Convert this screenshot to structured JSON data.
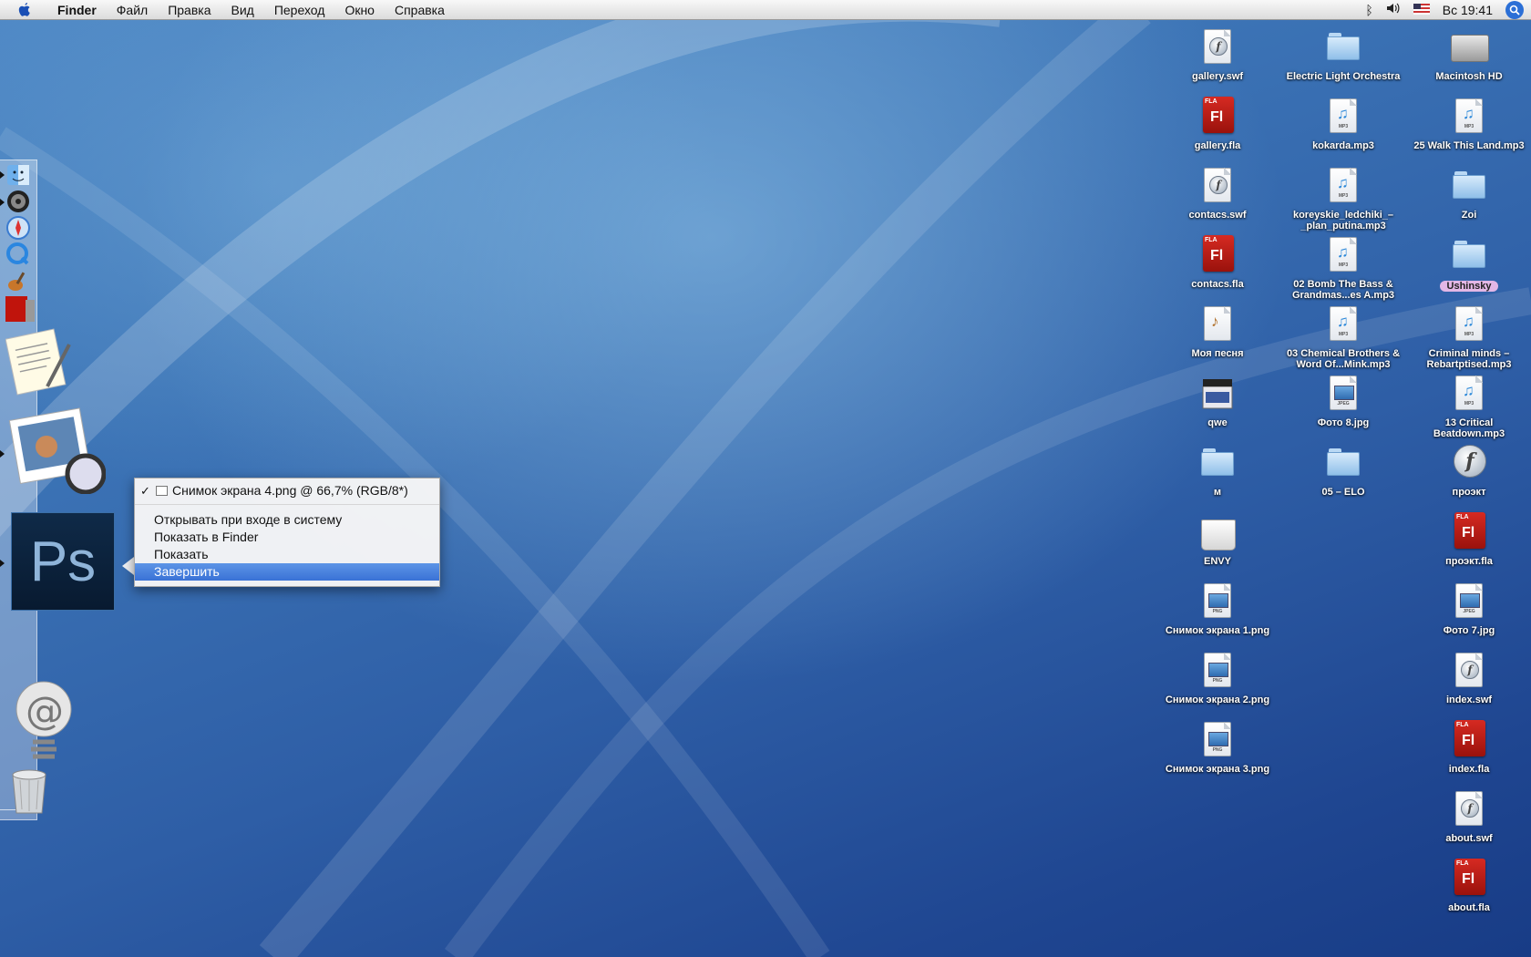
{
  "menubar": {
    "app_name": "Finder",
    "menus": [
      "Файл",
      "Правка",
      "Вид",
      "Переход",
      "Окно",
      "Справка"
    ],
    "clock": "Вс 19:41"
  },
  "context_menu": {
    "window_item": "Снимок экрана 4.png @ 66,7% (RGB/8*)",
    "items": [
      "Открывать при входе в систему",
      "Показать в Finder",
      "Показать",
      "Завершить"
    ],
    "highlighted_item": "Завершить"
  },
  "dock": {
    "icons": [
      "finder-icon",
      "dvd-player-icon",
      "safari-icon",
      "quicktime-icon",
      "garageband-icon",
      "photo-booth-icon",
      "textedit-icon",
      "preview-icon",
      "photoshop-icon",
      "mail-icon",
      "trash-icon"
    ],
    "photoshop_text": "Ps"
  },
  "desktop": {
    "col1": [
      "gallery.swf",
      "gallery.fla",
      "contacs.swf",
      "contacs.fla",
      "Моя песня",
      "qwe",
      "м",
      "ENVY",
      "Снимок экрана 1.png",
      "Снимок экрана 2.png",
      "Снимок экрана 3.png"
    ],
    "col2": [
      "Electric Light Orchestra",
      "kokarda.mp3",
      "koreyskie_ledchiki_–_plan_putina.mp3",
      "02 Bomb The Bass & Grandmas...es A.mp3",
      "03 Chemical Brothers & Word Of...Mink.mp3",
      "Фото 8.jpg",
      "05 – ELO"
    ],
    "col3": [
      "Macintosh HD",
      "25 Walk This Land.mp3",
      "Zoi",
      "Ushinsky",
      "Criminal minds – Rebartptised.mp3",
      "13 Critical Beatdown.mp3",
      "проэкт",
      "проэкт.fla",
      "Фото 7.jpg",
      "index.swf",
      "index.fla",
      "about.swf",
      "about.fla"
    ]
  },
  "file_caps": {
    "mp3": "MP3",
    "jpeg": "JPEG",
    "png": "PNG",
    "fla": "FLA",
    "fl": "Fl"
  },
  "colors": {
    "desktop": "#2e5ea6",
    "highlight": "#3a72d6",
    "tag_purple": "#e3b7e6"
  }
}
